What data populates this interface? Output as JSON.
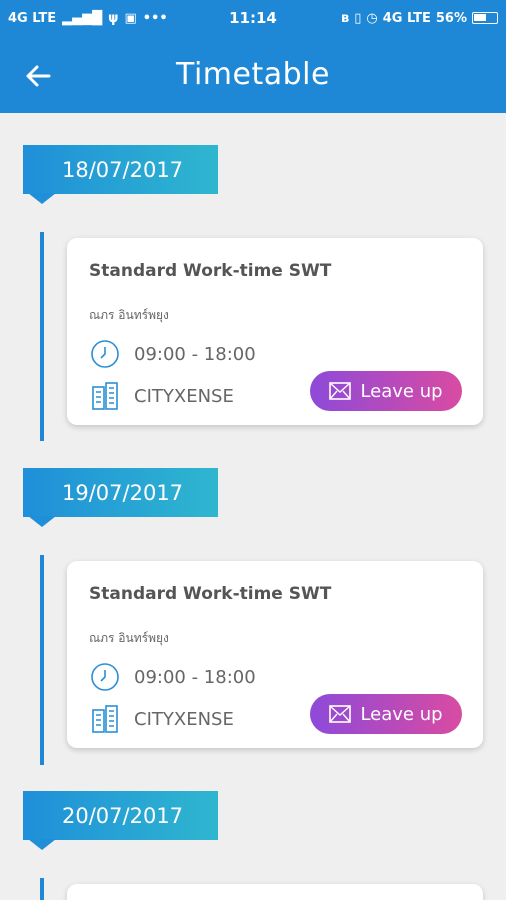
{
  "status_bar": {
    "left_text": "4G LTE",
    "signal": "signal-bars-icon",
    "time": "11:14",
    "battery_text": "56%",
    "network_right": "4G LTE"
  },
  "header": {
    "title": "Timetable",
    "back_icon": "arrow-left-icon",
    "background": "#1e88d6"
  },
  "accent": {
    "date_tag_gradient": [
      "#1f8fd9",
      "#2fb6cf"
    ],
    "leave_button_gradient": [
      "#8e4ad9",
      "#d94ba2"
    ],
    "timeline_line": "#1e88d6"
  },
  "days": [
    {
      "date": "18/07/2017",
      "shift": {
        "title": "Standard Work-time SWT",
        "person": "ณภร อินทร์พยุง",
        "time": "09:00 - 18:00",
        "place": "CITYXENSE",
        "action_label": "Leave up"
      }
    },
    {
      "date": "19/07/2017",
      "shift": {
        "title": "Standard Work-time SWT",
        "person": "ณภร อินทร์พยุง",
        "time": "09:00 - 18:00",
        "place": "CITYXENSE",
        "action_label": "Leave up"
      }
    },
    {
      "date": "20/07/2017"
    }
  ]
}
